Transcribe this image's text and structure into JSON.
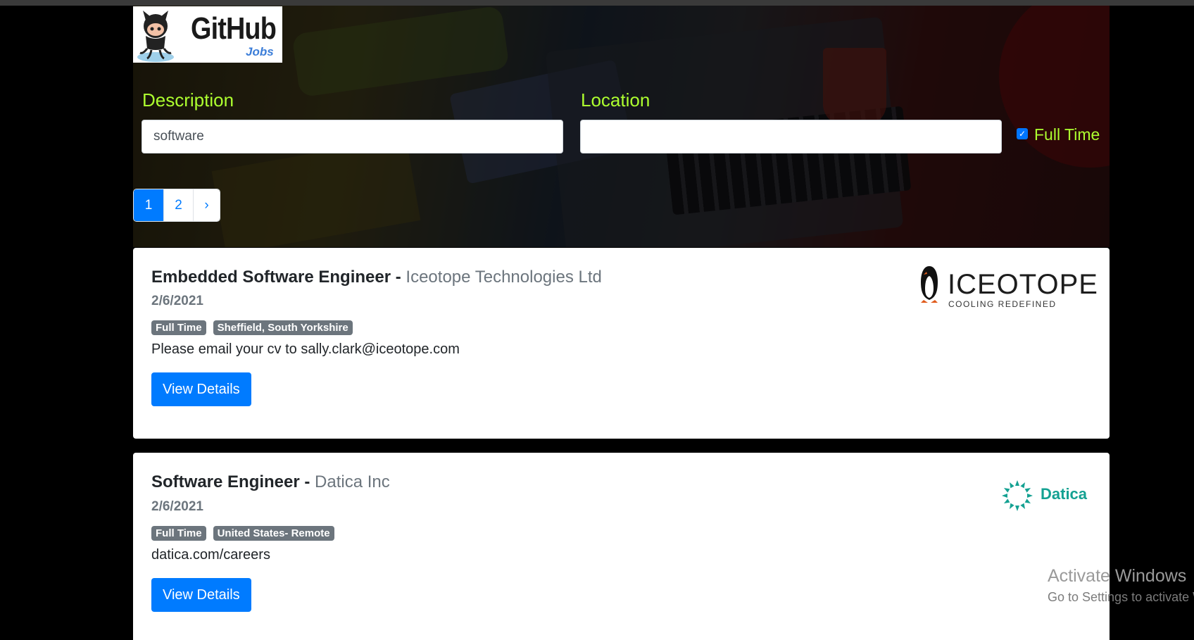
{
  "logo": {
    "brand": "GitHub",
    "sub": "Jobs"
  },
  "search": {
    "description_label": "Description",
    "description_value": "software",
    "location_label": "Location",
    "location_value": "",
    "full_time_label": "Full Time",
    "full_time_checked": true
  },
  "pagination": {
    "pages": [
      "1",
      "2"
    ],
    "next": "›",
    "active": "1"
  },
  "jobs": [
    {
      "title": "Embedded Software Engineer",
      "separator": " - ",
      "company": "Iceotope Technologies Ltd",
      "date": "2/6/2021",
      "badges": [
        "Full Time",
        "Sheffield, South Yorkshire"
      ],
      "description": "Please email your cv to sally.clark@iceotope.com",
      "button": "View Details",
      "logo": {
        "name": "ICEOTOPE",
        "tagline": "COOLING REDEFINED",
        "icon": "penguin-icon"
      }
    },
    {
      "title": "Software Engineer",
      "separator": " - ",
      "company": "Datica Inc",
      "date": "2/6/2021",
      "badges": [
        "Full Time",
        "United States- Remote"
      ],
      "description": "datica.com/careers",
      "button": "View Details",
      "logo": {
        "name": "Datica",
        "icon": "spiral-icon",
        "color": "#14a192"
      }
    }
  ],
  "watermark": {
    "line1": "Activate Windows",
    "line2": "Go to Settings to activate Windows."
  },
  "colors": {
    "label": "#adff2f",
    "primary": "#007bff",
    "badge": "#6c757d"
  }
}
